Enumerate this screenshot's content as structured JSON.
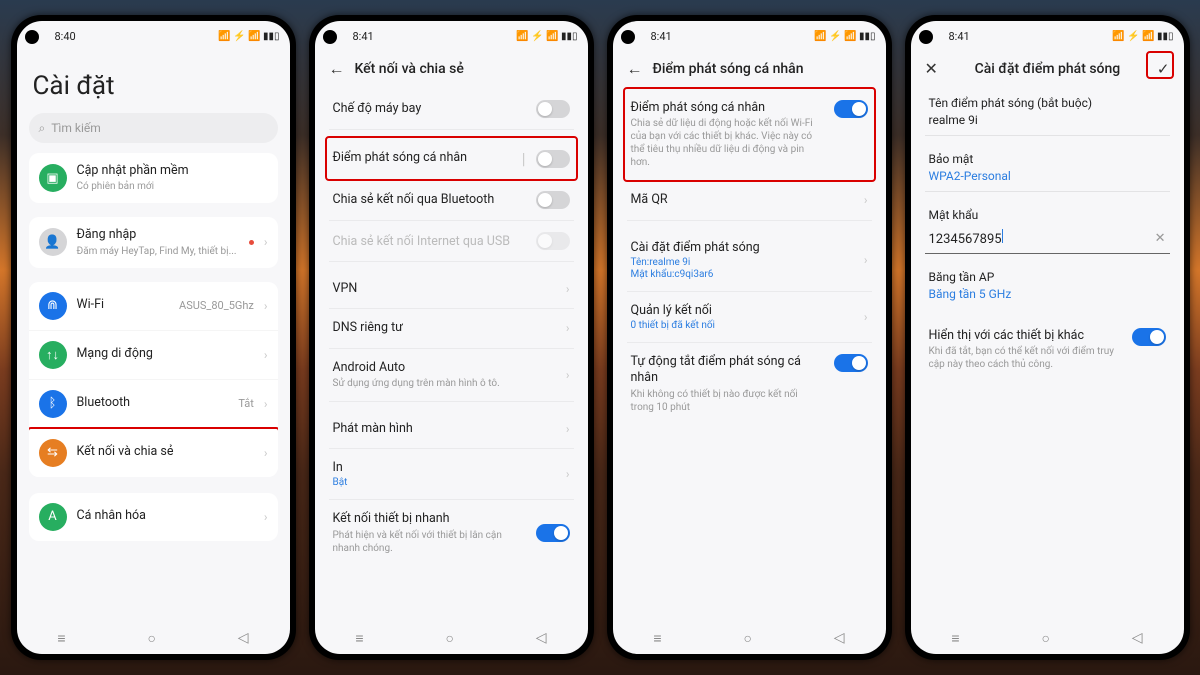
{
  "status": {
    "t1": "8:40",
    "t2": "8:41",
    "t3": "8:41",
    "t4": "8:41"
  },
  "nav_icons": {
    "recent": "≡",
    "home": "○",
    "back": "◁"
  },
  "sb_right": "📶 ⚡ 📶 ▮▮▯",
  "p1": {
    "title": "Cài đặt",
    "search_placeholder": "Tìm kiếm",
    "update": {
      "title": "Cập nhật phần mềm",
      "sub": "Có phiên bản mới"
    },
    "signin": {
      "title": "Đăng nhập",
      "sub": "Đăm máy HeyTap, Find My, thiết bị..."
    },
    "wifi": {
      "title": "Wi-Fi",
      "val": "ASUS_80_5Ghz"
    },
    "mobile": "Mạng di động",
    "bt": {
      "title": "Bluetooth",
      "val": "Tắt"
    },
    "conn": "Kết nối và chia sẻ",
    "personal": "Cá nhân hóa"
  },
  "p2": {
    "title": "Kết nối và chia sẻ",
    "airplane": "Chế độ máy bay",
    "hotspot": "Điểm phát sóng cá nhân",
    "btshare": "Chia sẻ kết nối qua Bluetooth",
    "usbshare": "Chia sẻ kết nối Internet qua USB",
    "vpn": "VPN",
    "dns": "DNS riêng tư",
    "aa": {
      "title": "Android Auto",
      "sub": "Sử dụng ứng dụng trên màn hình ô tô."
    },
    "cast": "Phát màn hình",
    "print": {
      "title": "In",
      "sub": "Bật"
    },
    "nearby": {
      "title": "Kết nối thiết bị nhanh",
      "sub": "Phát hiện và kết nối với thiết bị lân cận nhanh chóng."
    }
  },
  "p3": {
    "title": "Điểm phát sóng cá nhân",
    "hotspot": {
      "title": "Điểm phát sóng cá nhân",
      "sub": "Chia sẻ dữ liệu di động hoặc kết nối Wi-Fi của bạn với các thiết bị khác. Việc này có thể tiêu thụ nhiều dữ liệu di động và pin hơn."
    },
    "qr": "Mã QR",
    "config": {
      "title": "Cài đặt điểm phát sóng",
      "name": "Tên:realme 9i",
      "pwd": "Mật khẩu:c9qi3ar6"
    },
    "manage": {
      "title": "Quản lý kết nối",
      "sub": "0 thiết bị đã kết nối"
    },
    "autooff": {
      "title": "Tự động tắt điểm phát sóng cá nhân",
      "sub": "Khi không có thiết bị nào được kết nối trong 10 phút"
    }
  },
  "p4": {
    "title": "Cài đặt điểm phát sóng",
    "name_label": "Tên điểm phát sóng (bắt buộc)",
    "name_value": "realme 9i",
    "security_label": "Bảo mật",
    "security_value": "WPA2-Personal",
    "password_label": "Mật khẩu",
    "password_value": "1234567895",
    "band_label": "Băng tần AP",
    "band_value": "Băng tần 5 GHz",
    "visible": {
      "title": "Hiển thị với các thiết bị khác",
      "sub": "Khi đã tắt, bạn có thể kết nối với điểm truy cập này theo cách thủ công."
    }
  }
}
